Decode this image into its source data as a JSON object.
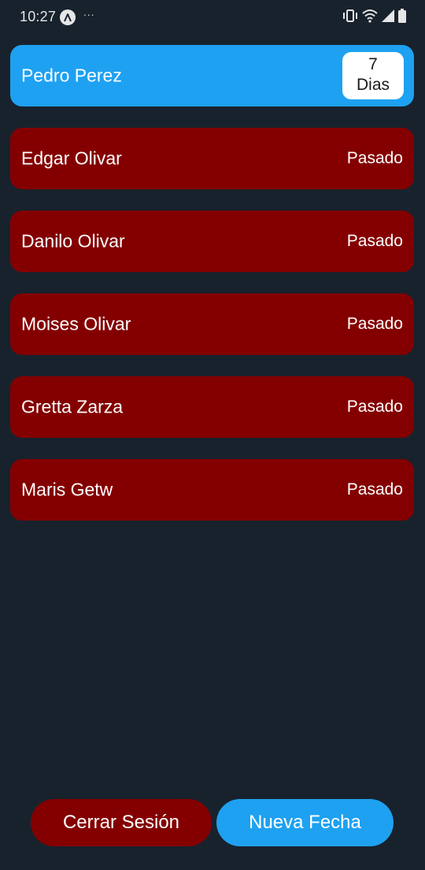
{
  "status_bar": {
    "time": "10:27",
    "notification_dots": "∙∙∙",
    "icons": [
      "app-notification-icon",
      "vibrate-icon",
      "wifi-icon",
      "signal-icon",
      "battery-icon"
    ]
  },
  "appointments": {
    "upcoming": {
      "name": "Pedro Perez",
      "days_number": "7",
      "days_unit": "Dias"
    },
    "past": [
      {
        "name": "Edgar Olivar",
        "status": "Pasado"
      },
      {
        "name": "Danilo Olivar",
        "status": "Pasado"
      },
      {
        "name": "Moises Olivar",
        "status": "Pasado"
      },
      {
        "name": "Gretta Zarza",
        "status": "Pasado"
      },
      {
        "name": "Maris Getw",
        "status": "Pasado"
      }
    ]
  },
  "actions": {
    "logout_label": "Cerrar Sesión",
    "new_date_label": "Nueva Fecha"
  },
  "colors": {
    "background": "#18222d",
    "upcoming": "#1ea1f1",
    "past": "#840000",
    "badge": "#ffffff"
  }
}
